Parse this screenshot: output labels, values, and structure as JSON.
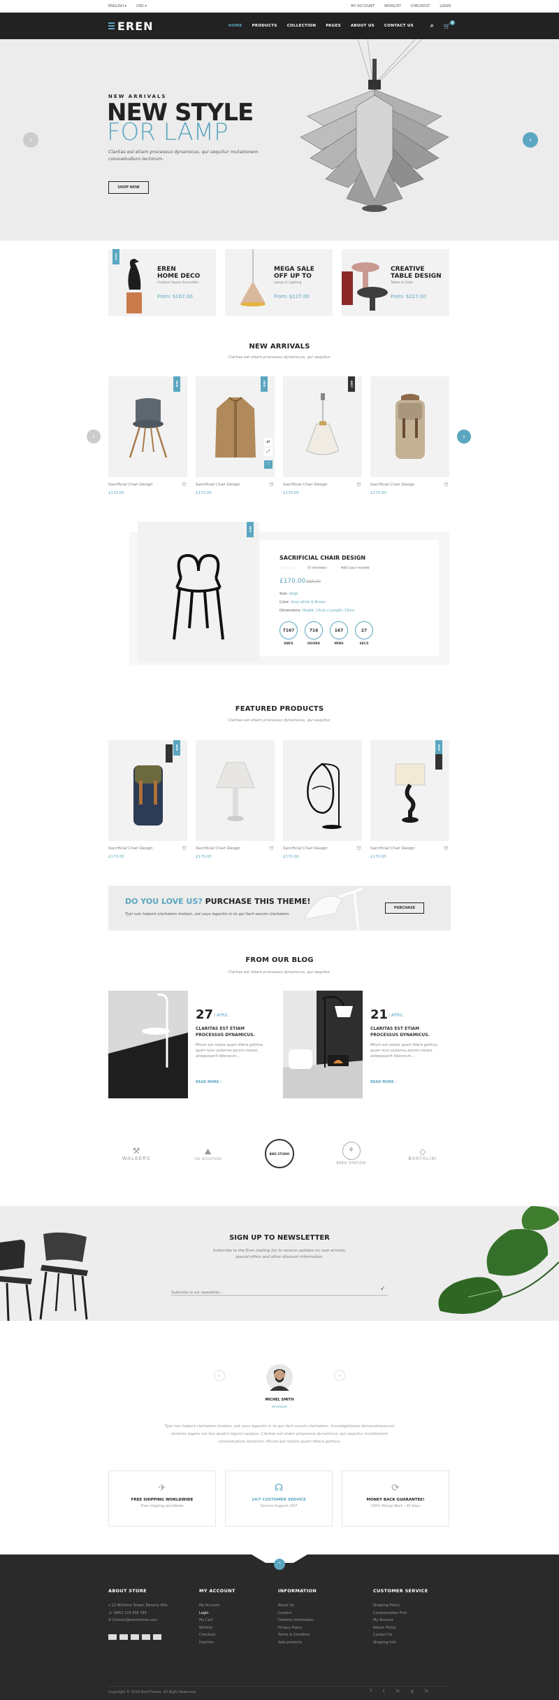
{
  "topbar": {
    "language": "ENGLISH",
    "currency": "USD",
    "links": [
      "MY ACCOUNT",
      "WISHLIST",
      "CHECKOUT",
      "LOGIN"
    ]
  },
  "header": {
    "logo": "EREN",
    "nav": [
      "HOME",
      "PRODUCTS",
      "COLLECTION",
      "PAGES",
      "ABOUT US",
      "CONTACT US"
    ],
    "cart_count": "0"
  },
  "hero": {
    "sub": "NEW ARRIVALS",
    "title1": "NEW STYLE",
    "title2": "FOR LAMP",
    "desc": "Claritas est etiam processus dynamicus, qui sequitur mutationem consuetudium lectorum.",
    "button": "SHOP NOW"
  },
  "promos": [
    {
      "flag": "SALE",
      "title1": "EREN",
      "title2": "HOME DECO",
      "sub": "Creative Space Accessible",
      "price": "From: $167.00"
    },
    {
      "title1": "MEGA SALE",
      "title2": "OFF UP TO",
      "sub": "Lamps & Lighting",
      "price": "From: $127.00"
    },
    {
      "title1": "CREATIVE",
      "title2": "TABLE DESIGN",
      "sub": "Tables & Chair",
      "price": "From: $227.00"
    }
  ],
  "new_arrivals": {
    "title": "NEW ARRIVALS",
    "sub": "Claritas est etiam processus dynamicus, qui sequitur.",
    "items": [
      {
        "name": "Sacrificial Chair Design",
        "price": "£170.00",
        "flag": "NEW"
      },
      {
        "name": "Sacrificial Chair Design",
        "price": "£170.00",
        "flag": "NEW"
      },
      {
        "name": "Sacrificial Chair Design",
        "price": "£170.00",
        "flag": "BEST"
      },
      {
        "name": "Sacrificial Chair Design",
        "price": "£170.00",
        "flag": ""
      }
    ]
  },
  "deal": {
    "flag": "NEW",
    "title": "SACRIFICIAL CHAIR DESIGN",
    "reviews": "(0 reviews)",
    "add_review": "Add your review",
    "price": "£170.00",
    "old_price": "£89.00",
    "size_label": "Size:",
    "size": "large",
    "color_label": "Color:",
    "color": "Gray white & Brown",
    "dim_label": "Dimensions:",
    "dim": "Height: 15cm x Length: 15cm",
    "countdown": [
      {
        "value": "7167",
        "label": "DAYS"
      },
      {
        "value": "716",
        "label": "HOURS"
      },
      {
        "value": "167",
        "label": "MINS"
      },
      {
        "value": "27",
        "label": "SECS"
      }
    ]
  },
  "featured": {
    "title": "FEATURED PRODUCTS",
    "sub": "Claritas est etiam processus dynamicus, qui sequitur.",
    "items": [
      {
        "name": "Sacrificial Chair Design",
        "price": "£170.00",
        "flag": "NEW"
      },
      {
        "name": "Sacrificial Chair Design",
        "price": "£170.00",
        "flag": ""
      },
      {
        "name": "Sacrificial Chair Design",
        "price": "£170.00",
        "flag": ""
      },
      {
        "name": "Sacrificial Chair Design",
        "price": "£170.00",
        "flag": "NEW"
      }
    ]
  },
  "banner": {
    "title_a": "DO YOU LOVE US?",
    "title_b": "PURCHASE THIS THEME!",
    "sub": "Typi non habent claritatem insitam, est usus legentis in iis qui facit eorum claritatem.",
    "button": "PURCHASE"
  },
  "blog": {
    "title": "FROM OUR BLOG",
    "sub": "Claritas est etiam processus dynamicus, qui sequitur.",
    "posts": [
      {
        "day": "27",
        "month": "/ APRIL",
        "title": "CLARITAS EST ETIAM PROCESSUS DYNAMICUS.",
        "text": "Mirum est notare quam littera gothica, quam nunc putamus parum claram, anteposuerit litterarum...",
        "more": "READ MORE"
      },
      {
        "day": "21",
        "month": "/ APRIL",
        "title": "CLARITAS EST ETIAM PROCESSUS DYNAMICUS.",
        "text": "Mirum est notare quam littera gothica, quam nunc putamus parum claram, anteposuerit litterarum...",
        "more": "READ MORE"
      }
    ]
  },
  "brands": [
    "WALKERS",
    "THE MOUNTAINS",
    "BIKE STUDIO",
    "BEER STATION",
    "BORTOLINI"
  ],
  "newsletter": {
    "title": "SIGN UP TO NEWSLETTER",
    "sub": "Subscribe to the Eren mailing list to receive updates on new arrivals, special offers and other discount information.",
    "placeholder": "Subscribe to our newsletter..."
  },
  "testimonial": {
    "name": "MICHEL SMITH",
    "role": "developer",
    "text": "Typi non habent claritatem insitam, est usus legentis in iis qui facit eorum claritatem. Investigationes demonstraverunt lectores legere me lius quod ii legunt saepius. Claritas est etiam processus dynamicus, qui sequitur mutationem consuetudium lectorum. Mirum est notare quam littera gothica."
  },
  "services": [
    {
      "title": "FREE SHIPPING WORLDWIDE",
      "sub": "Free shipping worldwide",
      "icon": "plane-icon"
    },
    {
      "title": "24/7 CUSTOMER SERVICE",
      "sub": "Service Support 24/7",
      "icon": "headset-icon"
    },
    {
      "title": "MONEY BACK GUARANTEE!",
      "sub": "100% Money Back - 30 Days",
      "icon": "refresh-icon"
    }
  ],
  "footer": {
    "about": {
      "title": "ABOUT STORE",
      "lines": [
        "12 Wilshere Street, Beverly Hills",
        "(800) 123 456 789",
        "Contact@erentheme.com"
      ]
    },
    "account": {
      "title": "MY ACCOUNT",
      "links": [
        "My Account",
        "Login",
        "My Cart",
        "Wishlist",
        "Checkout",
        "Userinfo"
      ]
    },
    "info": {
      "title": "INFORMATION",
      "links": [
        "About Us",
        "Careers",
        "Delivery Information",
        "Privacy Policy",
        "Terms & Condition",
        "Sale products"
      ]
    },
    "service": {
      "title": "CUSTOMER SERVICE",
      "links": [
        "Shipping Policy",
        "Compensation First",
        "My Account",
        "Return Policy",
        "Contact Us",
        "Shipping Info"
      ]
    },
    "copyright": "Copyright © 2016 ErenTheme. All Right Reserved.",
    "social": [
      "f",
      "t",
      "in",
      "g",
      "in"
    ]
  },
  "colors": {
    "accent": "#5ba6c0",
    "dark": "#222222",
    "light": "#f2f2f2"
  }
}
